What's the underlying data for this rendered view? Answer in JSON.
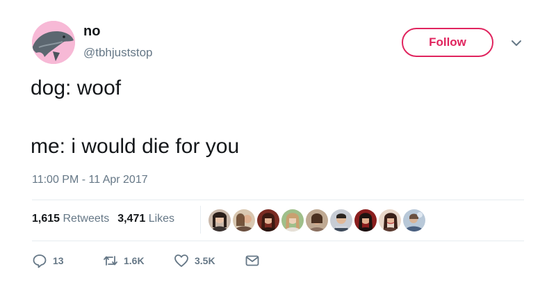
{
  "user": {
    "display_name": "no",
    "handle": "@tbhjuststop",
    "avatar_icon": "dolphin-avatar-icon",
    "avatar_bg": "#f7b9d6"
  },
  "follow_button": {
    "label": "Follow",
    "color": "#e0245e"
  },
  "tweet": {
    "line1": "dog: woof",
    "line2": "me: i would die for you",
    "timestamp": "11:00 PM - 11 Apr 2017"
  },
  "stats": {
    "retweets_count": "1,615",
    "retweets_label": "Retweets",
    "likes_count": "3,471",
    "likes_label": "Likes"
  },
  "likers_shown": 9,
  "actions": {
    "replies": "13",
    "retweets": "1.6K",
    "likes": "3.5K"
  },
  "colors": {
    "text": "#14171a",
    "secondary": "#657786",
    "divider": "#e6ecf0"
  }
}
